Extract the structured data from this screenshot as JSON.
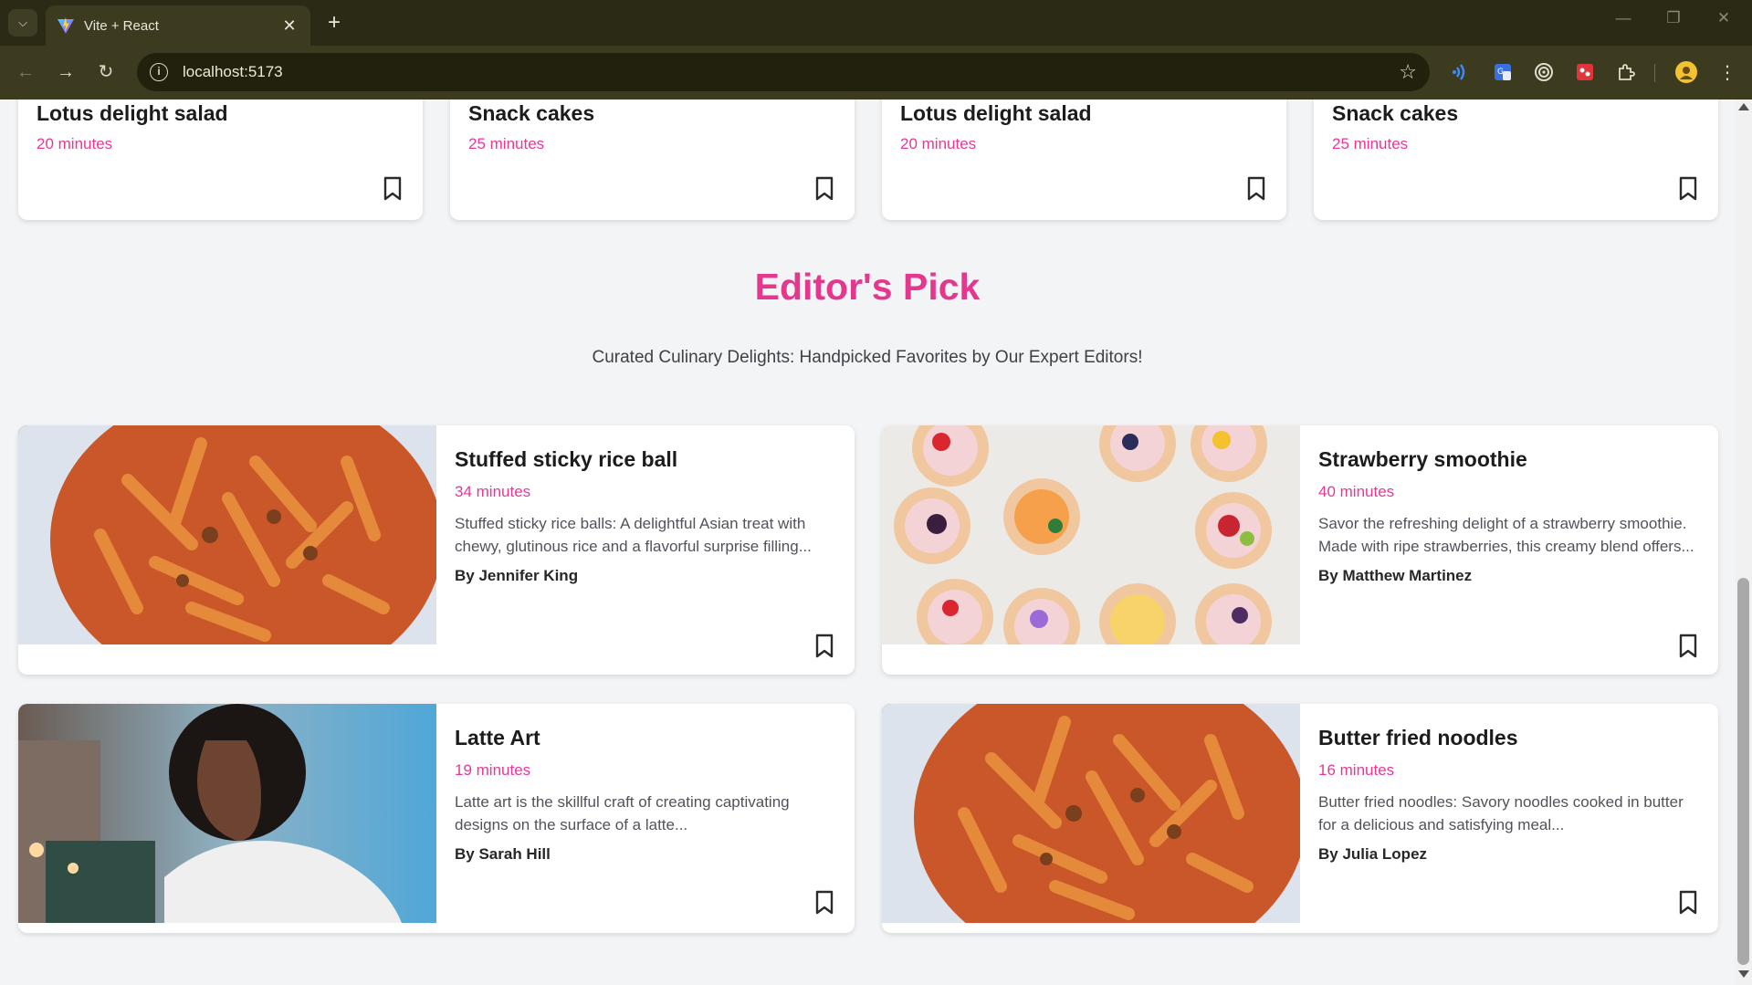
{
  "browser": {
    "tab_title": "Vite + React",
    "url": "localhost:5173"
  },
  "top_cards": [
    {
      "title": "Lotus delight salad",
      "time": "20 minutes"
    },
    {
      "title": "Snack cakes",
      "time": "25 minutes"
    },
    {
      "title": "Lotus delight salad",
      "time": "20 minutes"
    },
    {
      "title": "Snack cakes",
      "time": "25 minutes"
    }
  ],
  "section": {
    "heading": "Editor's Pick",
    "subheading": "Curated Culinary Delights: Handpicked Favorites by Our Expert Editors!"
  },
  "picks": [
    {
      "title": "Stuffed sticky rice ball",
      "time": "34 minutes",
      "description": "Stuffed sticky rice balls: A delightful Asian treat with chewy, glutinous rice and a flavorful surprise filling...",
      "author": "By Jennifer King",
      "image": "pasta-photo"
    },
    {
      "title": "Strawberry smoothie",
      "time": "40 minutes",
      "description": "Savor the refreshing delight of a strawberry smoothie. Made with ripe strawberries, this creamy blend offers...",
      "author": "By Matthew Martinez",
      "image": "fruit-tarts-photo"
    },
    {
      "title": "Latte Art",
      "time": "19 minutes",
      "description": "Latte art is the skillful craft of creating captivating designs on the surface of a latte...",
      "author": "By Sarah Hill",
      "image": "woman-portrait-photo"
    },
    {
      "title": "Butter fried noodles",
      "time": "16 minutes",
      "description": "Butter fried noodles: Savory noodles cooked in butter for a delicious and satisfying meal...",
      "author": "By Julia Lopez",
      "image": "pasta-photo"
    }
  ],
  "colors": {
    "accent": "#e4388f",
    "time": "#e63896",
    "chrome_bg": "#3c3b1f"
  }
}
